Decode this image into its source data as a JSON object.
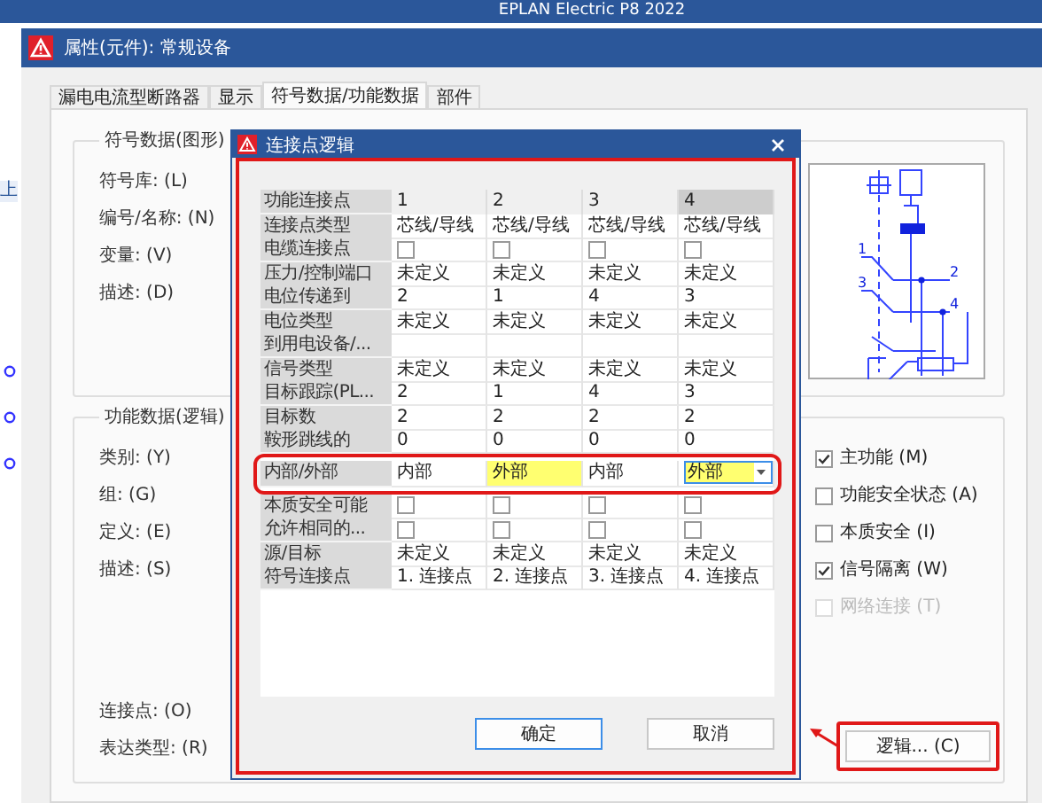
{
  "app_title": "EPLAN Electric P8 2022",
  "side_tab": "上",
  "window": {
    "title": "属性(元件): 常规设备"
  },
  "tabs": [
    {
      "label": "漏电电流型断路器",
      "selected": false
    },
    {
      "label": "显示",
      "selected": false
    },
    {
      "label": "符号数据/功能数据",
      "selected": true
    },
    {
      "label": "部件",
      "selected": false
    }
  ],
  "symbol_group": {
    "title": "符号数据(图形)",
    "fields": [
      "符号库: (L)",
      "编号/名称: (N)",
      "变量: (V)",
      "描述: (D)"
    ],
    "schematic_labels": [
      "1",
      "2",
      "3",
      "4"
    ]
  },
  "function_group": {
    "title": "功能数据(逻辑)",
    "fields": [
      "类别: (Y)",
      "组: (G)",
      "定义: (E)",
      "描述: (S)"
    ],
    "bottom_fields": [
      "连接点: (O)",
      "表达类型: (R)"
    ],
    "checkboxes": [
      {
        "label": "主功能 (M)",
        "checked": true,
        "disabled": false
      },
      {
        "label": "功能安全状态 (A)",
        "checked": false,
        "disabled": false
      },
      {
        "label": "本质安全 (I)",
        "checked": false,
        "disabled": false
      },
      {
        "label": "信号隔离 (W)",
        "checked": true,
        "disabled": false
      },
      {
        "label": "网络连接 (T)",
        "checked": false,
        "disabled": true
      }
    ],
    "logic_button": {
      "label": "逻辑... (C)",
      "marked": true
    }
  },
  "dialog": {
    "title": "连接点逻辑",
    "marked": true,
    "table": {
      "corner": "功能连接点",
      "columns": [
        {
          "label": "1",
          "selected": false
        },
        {
          "label": "2",
          "selected": false
        },
        {
          "label": "3",
          "selected": false
        },
        {
          "label": "4",
          "selected": true
        }
      ],
      "rows": [
        {
          "label": "连接点类型",
          "kind": "text",
          "marked": false,
          "cells": [
            "芯线/导线",
            "芯线/导线",
            "芯线/导线",
            "芯线/导线"
          ]
        },
        {
          "label": "电缆连接点",
          "kind": "checkbox",
          "marked": false,
          "cells": [
            {
              "checked": false
            },
            {
              "checked": false
            },
            {
              "checked": false
            },
            {
              "checked": false
            }
          ]
        },
        {
          "label": "压力/控制端口",
          "kind": "text",
          "marked": false,
          "cells": [
            "未定义",
            "未定义",
            "未定义",
            "未定义"
          ]
        },
        {
          "label": "电位传递到",
          "kind": "text",
          "marked": false,
          "cells": [
            "2",
            "1",
            "4",
            "3"
          ]
        },
        {
          "label": "电位类型",
          "kind": "text",
          "marked": false,
          "cells": [
            "未定义",
            "未定义",
            "未定义",
            "未定义"
          ]
        },
        {
          "label": "到用电设备/...",
          "kind": "empty",
          "marked": false
        },
        {
          "label": "信号类型",
          "kind": "text",
          "marked": false,
          "cells": [
            "未定义",
            "未定义",
            "未定义",
            "未定义"
          ]
        },
        {
          "label": "目标跟踪(PL...",
          "kind": "text",
          "marked": false,
          "cells": [
            "2",
            "1",
            "4",
            "3"
          ]
        },
        {
          "label": "目标数",
          "kind": "text",
          "marked": false,
          "cells": [
            "2",
            "2",
            "2",
            "2"
          ]
        },
        {
          "label": "鞍形跳线的",
          "kind": "text",
          "marked": false,
          "cells": [
            "0",
            "0",
            "0",
            "0"
          ]
        },
        {
          "label": "内部/外部",
          "kind": "choice",
          "marked": true,
          "cells": [
            {
              "text": "内部",
              "highlighted": false,
              "editing": false
            },
            {
              "text": "外部",
              "highlighted": true,
              "editing": false
            },
            {
              "text": "内部",
              "highlighted": false,
              "editing": false
            },
            {
              "text": "外部",
              "highlighted": true,
              "editing": true
            }
          ]
        },
        {
          "label": "本质安全可能",
          "kind": "checkbox",
          "marked": false,
          "cells": [
            {
              "checked": false
            },
            {
              "checked": false
            },
            {
              "checked": false
            },
            {
              "checked": false
            }
          ]
        },
        {
          "label": "允许相同的...",
          "kind": "checkbox",
          "marked": false,
          "cells": [
            {
              "checked": false
            },
            {
              "checked": false
            },
            {
              "checked": false
            },
            {
              "checked": false
            }
          ]
        },
        {
          "label": "源/目标",
          "kind": "text",
          "marked": false,
          "cells": [
            "未定义",
            "未定义",
            "未定义",
            "未定义"
          ]
        },
        {
          "label": "符号连接点",
          "kind": "text",
          "marked": false,
          "cells": [
            "1. 连接点",
            "2. 连接点",
            "3. 连接点",
            "4. 连接点"
          ]
        }
      ]
    },
    "buttons": [
      {
        "label": "确定",
        "default": true
      },
      {
        "label": "取消",
        "default": false
      }
    ]
  },
  "annotation_arrow": true
}
